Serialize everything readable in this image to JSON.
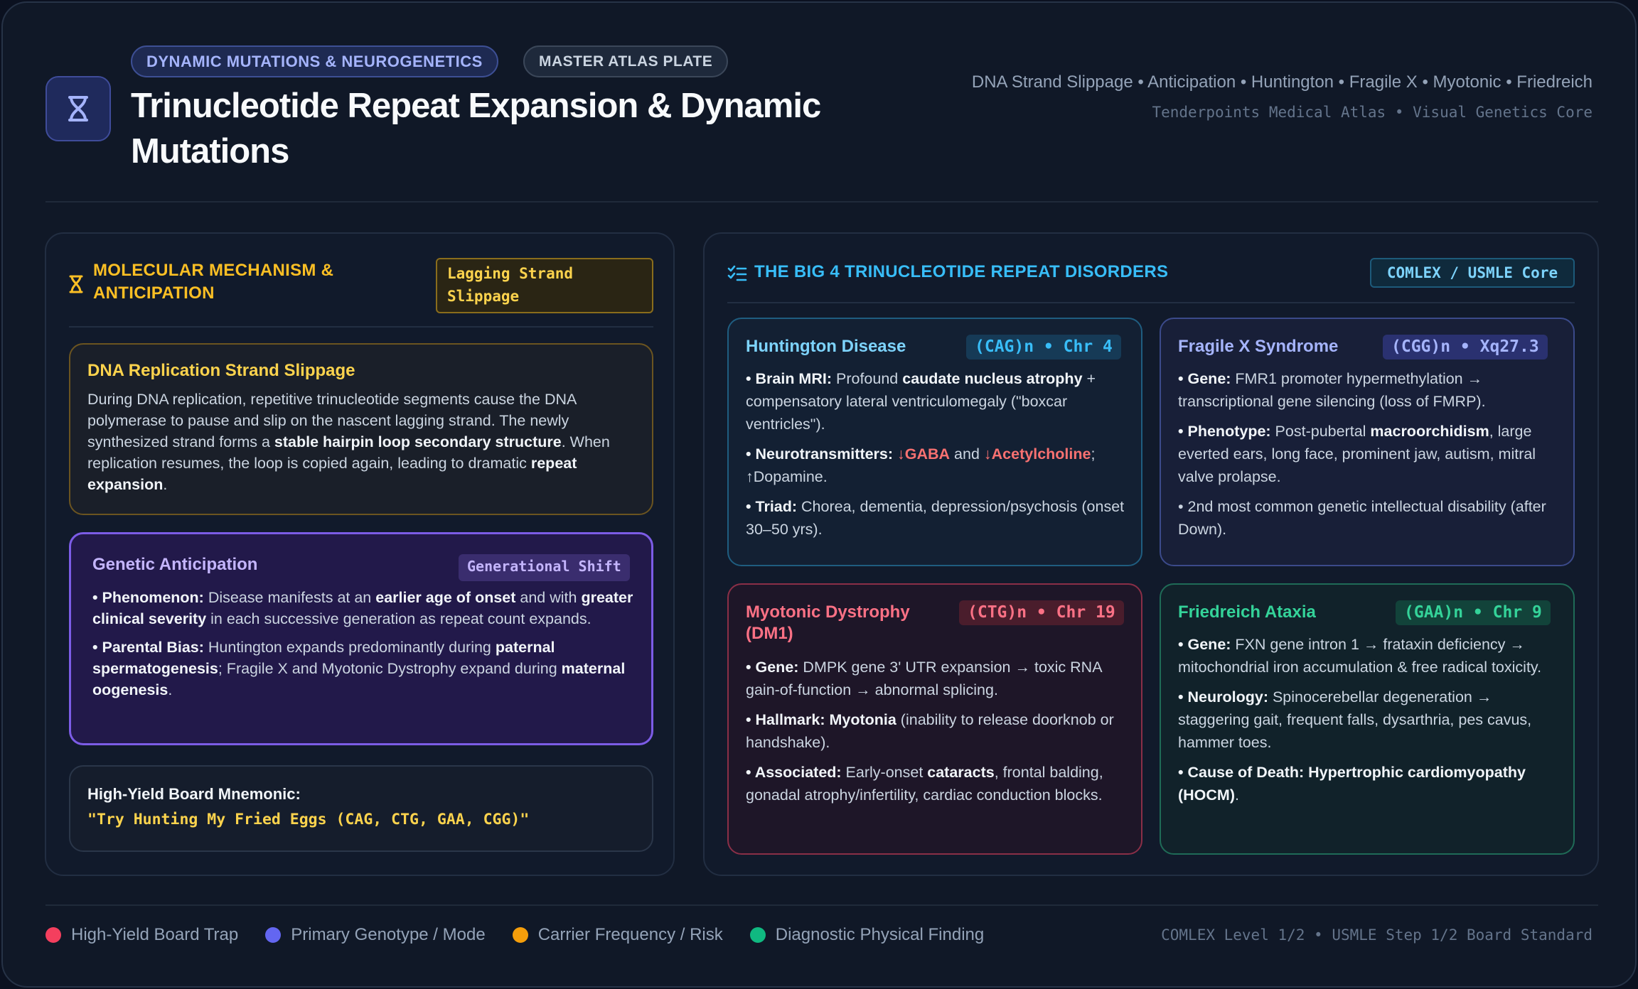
{
  "header": {
    "topic_pill": "DYNAMIC MUTATIONS & NEUROGENETICS",
    "plate_pill": "MASTER ATLAS PLATE",
    "title": "Trinucleotide Repeat Expansion & Dynamic Mutations",
    "topics": "DNA Strand Slippage • Anticipation • Huntington • Fragile X • Myotonic • Friedreich",
    "atlas_line": "Tenderpoints Medical Atlas • Visual Genetics Core",
    "logo_icon": "dna-icon"
  },
  "left_panel": {
    "title": "MOLECULAR MECHANISM & ANTICIPATION",
    "tag": "Lagging Strand Slippage",
    "slippage": {
      "title": "DNA Replication Strand Slippage",
      "t1": "During DNA replication, repetitive trinucleotide segments cause the DNA polymerase to pause and slip on the nascent lagging strand. The newly synthesized strand forms a ",
      "b1": "stable hairpin loop secondary structure",
      "t2": ". When replication resumes, the loop is copied again, leading to dramatic ",
      "b2": "repeat expansion",
      "t3": "."
    },
    "anticipation": {
      "title": "Genetic Anticipation",
      "tag": "Generational Shift",
      "p1_label": "• Phenomenon:",
      "p1_t1": " Disease manifests at an ",
      "p1_b1": "earlier age of onset",
      "p1_t2": " and with ",
      "p1_b2": "greater clinical severity",
      "p1_t3": " in each successive generation as repeat count expands.",
      "p2_label": "• Parental Bias:",
      "p2_t1": " Huntington expands predominantly during ",
      "p2_b1": "paternal spermatogenesis",
      "p2_t2": "; Fragile X and Myotonic Dystrophy expand during ",
      "p2_b2": "maternal oogenesis",
      "p2_t3": "."
    },
    "mnemonic": {
      "label": "High-Yield Board Mnemonic:",
      "text": "\"Try Hunting My Fried Eggs (CAG, CTG, GAA, CGG)\""
    }
  },
  "right_panel": {
    "title": "THE BIG 4 TRINUCLEOTIDE REPEAT DISORDERS",
    "tag": "COMLEX / USMLE Core",
    "huntington": {
      "title": "Huntington Disease",
      "tag": "(CAG)n • Chr 4",
      "p1_label": "• Brain MRI:",
      "p1_t1": " Profound ",
      "p1_b1": "caudate nucleus atrophy",
      "p1_t2": " + compensatory lateral ventriculomegaly (\"boxcar ventricles\").",
      "p2_label": "• Neurotransmitters:",
      "p2_r1": " ↓GABA",
      "p2_t1": " and ",
      "p2_r2": "↓Acetylcholine",
      "p2_t2": "; ↑Dopamine.",
      "p3_label": "• Triad:",
      "p3_t1": " Chorea, dementia, depression/psychosis (onset 30–50 yrs)."
    },
    "fragile_x": {
      "title": "Fragile X Syndrome",
      "tag": "(CGG)n • Xq27.3",
      "p1_label": "• Gene:",
      "p1_t1": " FMR1 promoter hypermethylation → transcriptional gene silencing (loss of FMRP).",
      "p2_label": "• Phenotype:",
      "p2_t1": " Post-pubertal ",
      "p2_b1": "macroorchidism",
      "p2_t2": ", large everted ears, long face, prominent jaw, autism, mitral valve prolapse.",
      "p3_t1": "• 2nd most common genetic intellectual disability (after Down)."
    },
    "myotonic": {
      "title": "Myotonic Dystrophy (DM1)",
      "tag": "(CTG)n • Chr 19",
      "p1_label": "• Gene:",
      "p1_t1": " DMPK gene 3' UTR expansion → toxic RNA gain-of-function → abnormal splicing.",
      "p2_label": "• Hallmark: Myotonia",
      "p2_t1": " (inability to release doorknob or handshake).",
      "p3_label": "• Associated:",
      "p3_t1": " Early-onset ",
      "p3_b1": "cataracts",
      "p3_t2": ", frontal balding, gonadal atrophy/infertility, cardiac conduction blocks."
    },
    "friedreich": {
      "title": "Friedreich Ataxia",
      "tag": "(GAA)n • Chr 9",
      "p1_label": "• Gene:",
      "p1_t1": " FXN gene intron 1 → frataxin deficiency → mitochondrial iron accumulation & free radical toxicity.",
      "p2_label": "• Neurology:",
      "p2_t1": " Spinocerebellar degeneration → staggering gait, frequent falls, dysarthria, pes cavus, hammer toes.",
      "p3_label": "• Cause of Death: Hypertrophic cardiomyopathy (HOCM)",
      "p3_t1": "."
    }
  },
  "legend": {
    "items": [
      {
        "label": "High-Yield Board Trap",
        "color": "#f43f5e"
      },
      {
        "label": "Primary Genotype / Mode",
        "color": "#6366f1"
      },
      {
        "label": "Carrier Frequency / Risk",
        "color": "#f59e0b"
      },
      {
        "label": "Diagnostic Physical Finding",
        "color": "#10b981"
      }
    ],
    "footer": "COMLEX Level 1/2 • USMLE Step 1/2 Board Standard"
  },
  "colors": {
    "amber": "#fbbf24",
    "violet": "#c4b5fd",
    "sky": "#38bdf8",
    "pink": "#fb7185",
    "emerald": "#34d399"
  }
}
